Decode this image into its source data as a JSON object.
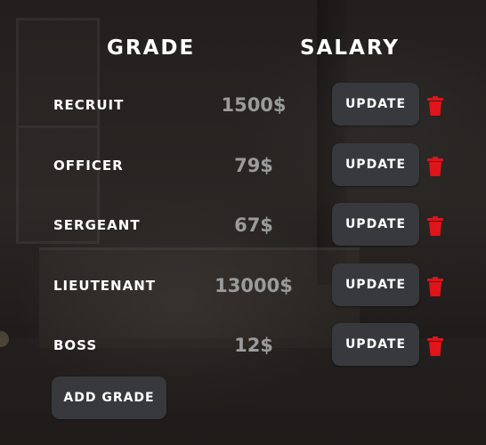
{
  "header": {
    "grade_label": "Grade",
    "salary_label": "Salary"
  },
  "grades": [
    {
      "name": "Recruit",
      "salary": "1500$"
    },
    {
      "name": "Officer",
      "salary": "79$"
    },
    {
      "name": "Sergeant",
      "salary": "67$"
    },
    {
      "name": "Lieutenant",
      "salary": "13000$"
    },
    {
      "name": "Boss",
      "salary": "12$"
    }
  ],
  "actions": {
    "update_label": "Update",
    "add_grade_label": "Add Grade",
    "delete_icon": "trash-icon"
  },
  "colors": {
    "delete_red": "#e0141b",
    "button_bg": "#38393c",
    "salary_gray": "#9b9b9b"
  }
}
